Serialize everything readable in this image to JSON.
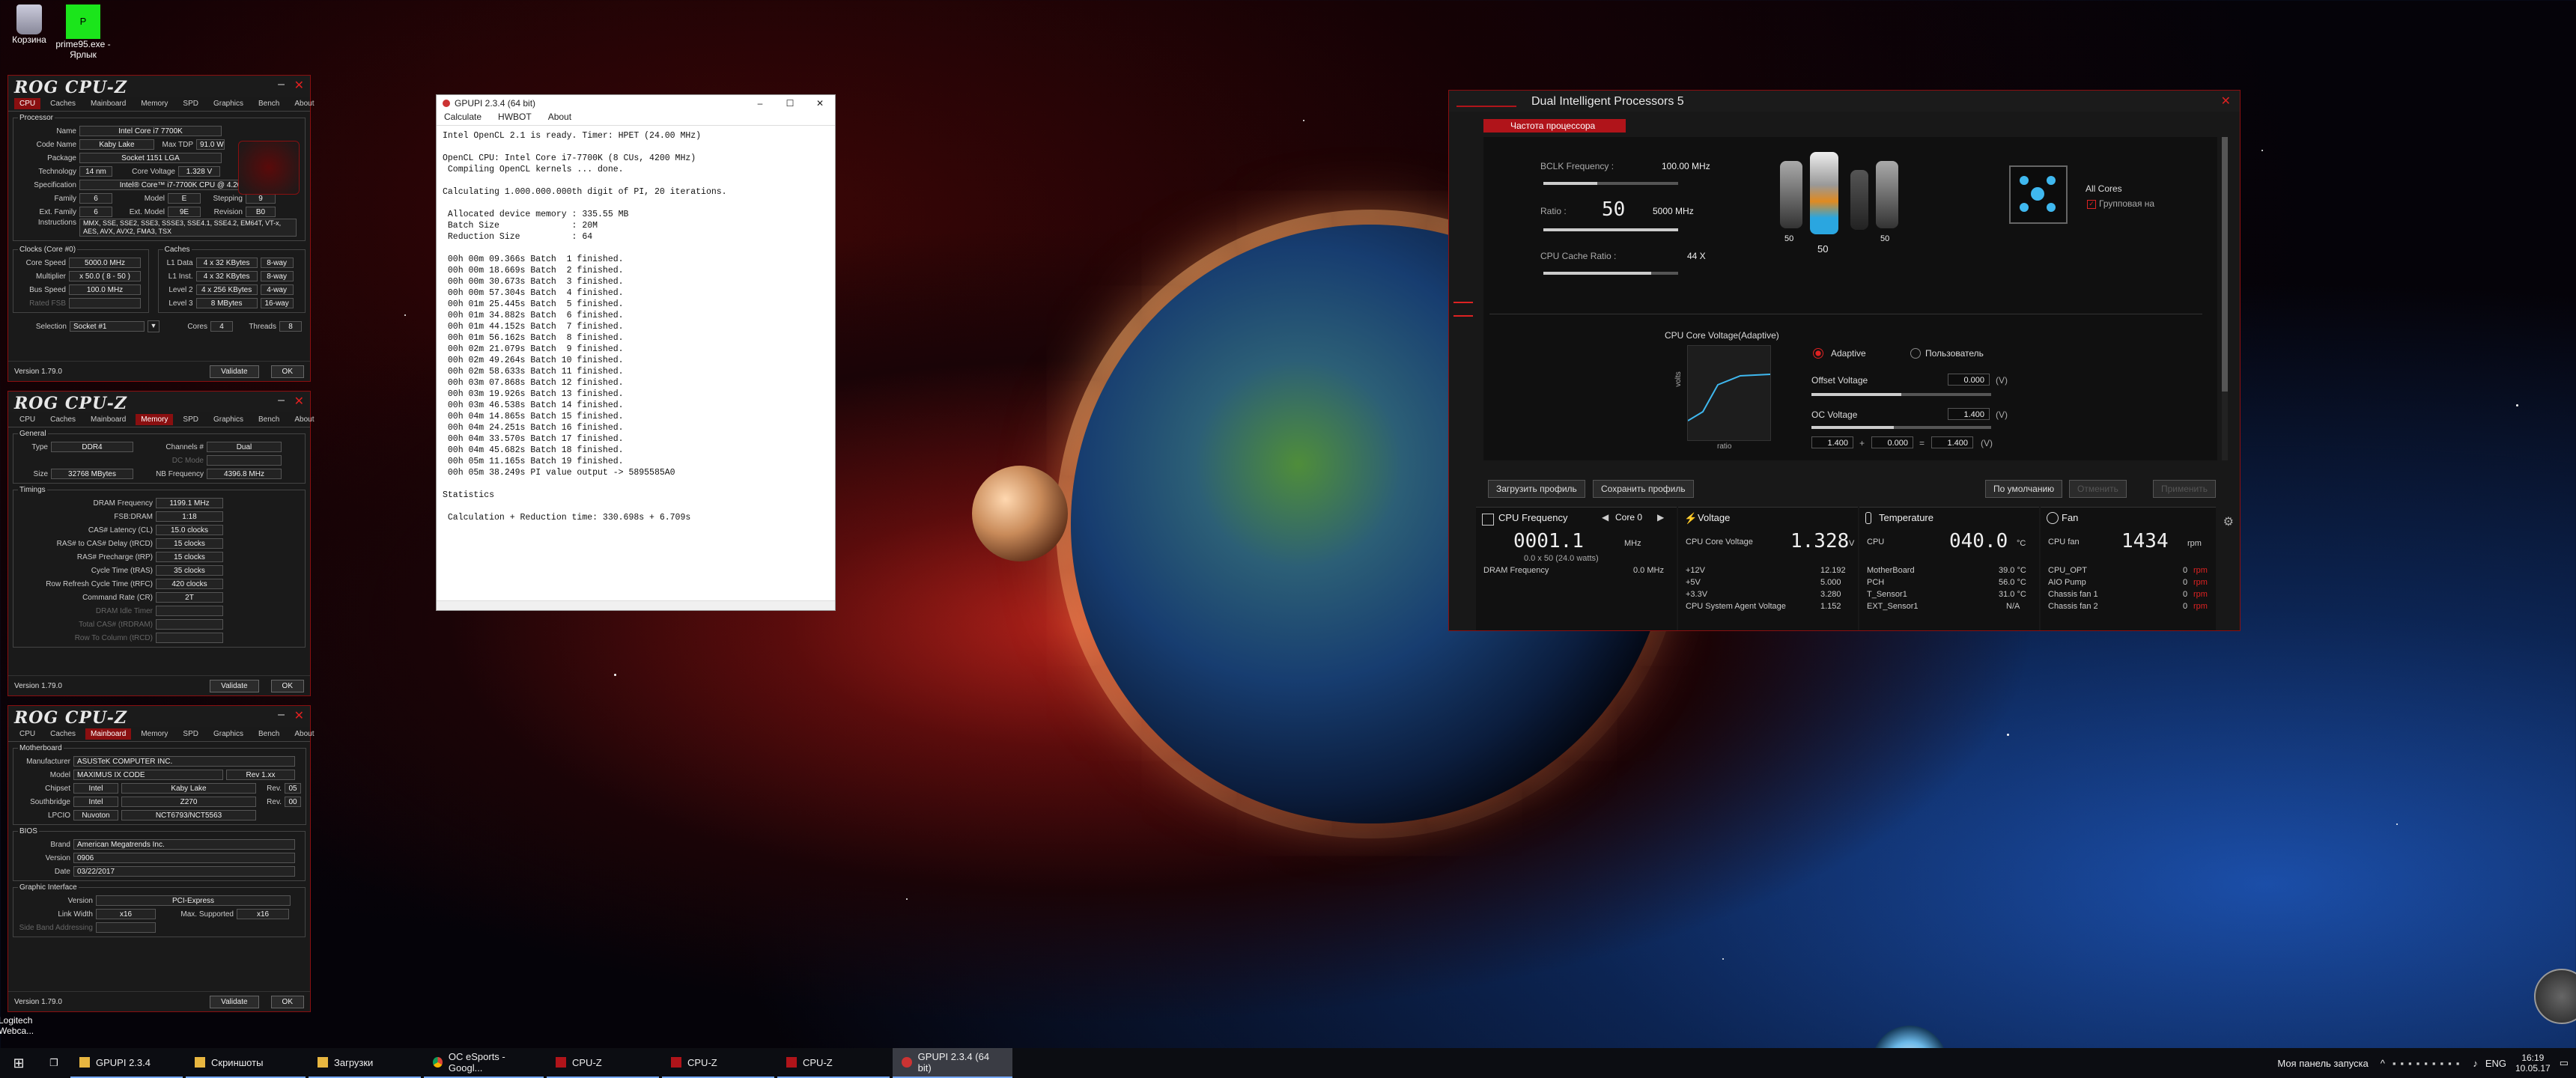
{
  "desktop": {
    "icons": [
      {
        "label": "Корзина"
      },
      {
        "label": "prime95.exe - Ярлык"
      }
    ],
    "logitech": "Logitech Webca..."
  },
  "cpuz_common": {
    "logo": "ROG CPU-Z",
    "tabs": [
      "CPU",
      "Caches",
      "Mainboard",
      "Memory",
      "SPD",
      "Graphics",
      "Bench",
      "About"
    ],
    "version": "Version 1.79.0",
    "validate": "Validate",
    "ok": "OK"
  },
  "cpuz_cpu": {
    "processor_legend": "Processor",
    "name_label": "Name",
    "name": "Intel Core i7 7700K",
    "codename_label": "Code Name",
    "codename": "Kaby Lake",
    "maxtdp_label": "Max TDP",
    "maxtdp": "91.0 W",
    "package_label": "Package",
    "package": "Socket 1151 LGA",
    "tech_label": "Technology",
    "tech": "14 nm",
    "corev_label": "Core Voltage",
    "corev": "1.328 V",
    "spec_label": "Specification",
    "spec": "Intel® Core™ i7-7700K CPU @ 4.20GHz",
    "family_label": "Family",
    "family": "6",
    "model_label": "Model",
    "model": "E",
    "stepping_label": "Stepping",
    "stepping": "9",
    "extfamily_label": "Ext. Family",
    "extfamily": "6",
    "extmodel_label": "Ext. Model",
    "extmodel": "9E",
    "revision_label": "Revision",
    "revision": "B0",
    "instr_label": "Instructions",
    "instr": "MMX, SSE, SSE2, SSE3, SSSE3, SSE4.1, SSE4.2, EM64T, VT-x, AES, AVX, AVX2, FMA3, TSX",
    "clocks_legend": "Clocks (Core #0)",
    "corespeed_label": "Core Speed",
    "corespeed": "5000.0 MHz",
    "multiplier_label": "Multiplier",
    "multiplier": "x 50.0 ( 8 - 50 )",
    "busspeed_label": "Bus Speed",
    "busspeed": "100.0 MHz",
    "ratedfsb_label": "Rated FSB",
    "caches_legend": "Caches",
    "l1d_label": "L1 Data",
    "l1d": "4 x 32 KBytes",
    "l1d_way": "8-way",
    "l1i_label": "L1 Inst.",
    "l1i": "4 x 32 KBytes",
    "l1i_way": "8-way",
    "l2_label": "Level 2",
    "l2": "4 x 256 KBytes",
    "l2_way": "4-way",
    "l3_label": "Level 3",
    "l3": "8 MBytes",
    "l3_way": "16-way",
    "selection_label": "Selection",
    "selection": "Socket #1",
    "cores_label": "Cores",
    "cores": "4",
    "threads_label": "Threads",
    "threads": "8"
  },
  "cpuz_mem": {
    "general_legend": "General",
    "type_label": "Type",
    "type": "DDR4",
    "channels_label": "Channels #",
    "channels": "Dual",
    "dcmode_label": "DC Mode",
    "size_label": "Size",
    "size": "32768 MBytes",
    "nbfreq_label": "NB Frequency",
    "nbfreq": "4396.8 MHz",
    "timings_legend": "Timings",
    "timings": [
      {
        "label": "DRAM Frequency",
        "value": "1199.1 MHz"
      },
      {
        "label": "FSB:DRAM",
        "value": "1:18"
      },
      {
        "label": "CAS# Latency (CL)",
        "value": "15.0 clocks"
      },
      {
        "label": "RAS# to CAS# Delay (tRCD)",
        "value": "15 clocks"
      },
      {
        "label": "RAS# Precharge (tRP)",
        "value": "15 clocks"
      },
      {
        "label": "Cycle Time (tRAS)",
        "value": "35 clocks"
      },
      {
        "label": "Row Refresh Cycle Time (tRFC)",
        "value": "420 clocks"
      },
      {
        "label": "Command Rate (CR)",
        "value": "2T"
      },
      {
        "label": "DRAM Idle Timer",
        "value": ""
      },
      {
        "label": "Total CAS# (tRDRAM)",
        "value": ""
      },
      {
        "label": "Row To Column (tRCD)",
        "value": ""
      }
    ]
  },
  "cpuz_mb": {
    "mb_legend": "Motherboard",
    "manu_label": "Manufacturer",
    "manu": "ASUSTeK COMPUTER INC.",
    "model_label": "Model",
    "model": "MAXIMUS IX CODE",
    "model_rev": "Rev 1.xx",
    "chipset_label": "Chipset",
    "chipset_v": "Intel",
    "chipset": "Kaby Lake",
    "chipset_rev_label": "Rev.",
    "chipset_rev": "05",
    "south_label": "Southbridge",
    "south_v": "Intel",
    "south": "Z270",
    "south_rev_label": "Rev.",
    "south_rev": "00",
    "lpcio_label": "LPCIO",
    "lpcio_v": "Nuvoton",
    "lpcio": "NCT6793/NCT5563",
    "bios_legend": "BIOS",
    "brand_label": "Brand",
    "brand": "American Megatrends Inc.",
    "version_label": "Version",
    "version": "0906",
    "date_label": "Date",
    "date": "03/22/2017",
    "gi_legend": "Graphic Interface",
    "giver_label": "Version",
    "giver": "PCI-Express",
    "lw_label": "Link Width",
    "lw": "x16",
    "maxsup_label": "Max. Supported",
    "maxsup": "x16",
    "sideband_label": "Side Band Addressing"
  },
  "gpupi": {
    "title": "GPUPI 2.3.4 (64 bit)",
    "menu": [
      "Calculate",
      "HWBOT",
      "About"
    ],
    "console": "Intel OpenCL 2.1 is ready. Timer: HPET (24.00 MHz)\n\nOpenCL CPU: Intel Core i7-7700K (8 CUs, 4200 MHz)\n Compiling OpenCL kernels ... done.\n\nCalculating 1.000.000.000th digit of PI, 20 iterations.\n\n Allocated device memory : 335.55 MB\n Batch Size              : 20M\n Reduction Size          : 64\n\n 00h 00m 09.366s Batch  1 finished.\n 00h 00m 18.669s Batch  2 finished.\n 00h 00m 30.673s Batch  3 finished.\n 00h 00m 57.304s Batch  4 finished.\n 00h 01m 25.445s Batch  5 finished.\n 00h 01m 34.882s Batch  6 finished.\n 00h 01m 44.152s Batch  7 finished.\n 00h 01m 56.162s Batch  8 finished.\n 00h 02m 21.079s Batch  9 finished.\n 00h 02m 49.264s Batch 10 finished.\n 00h 02m 58.633s Batch 11 finished.\n 00h 03m 07.868s Batch 12 finished.\n 00h 03m 19.926s Batch 13 finished.\n 00h 03m 46.538s Batch 14 finished.\n 00h 04m 14.865s Batch 15 finished.\n 00h 04m 24.251s Batch 16 finished.\n 00h 04m 33.570s Batch 17 finished.\n 00h 04m 45.682s Batch 18 finished.\n 00h 05m 11.165s Batch 19 finished.\n 00h 05m 38.249s PI value output -> 5895585A0\n\nStatistics\n\n Calculation + Reduction time: 330.698s + 6.709s"
  },
  "dip": {
    "title": "Dual Intelligent Processors 5",
    "tab": "Частота процессора",
    "bclk_label": "BCLK Frequency :",
    "bclk": "100.00 MHz",
    "ratio_label": "Ratio :",
    "ratio_big": "50",
    "ratio_mhz": "5000 MHz",
    "cache_label": "CPU Cache Ratio :",
    "cache_ratio": "44 X",
    "core_marks": [
      "50",
      "50",
      "50"
    ],
    "all_cores": "All Cores",
    "group": "Групповая на",
    "voltage_title": "CPU Core Voltage(Adaptive)",
    "volts": "volts",
    "ratio_axis": "ratio",
    "adaptive": "Adaptive",
    "user": "Пользователь",
    "offset_label": "Offset Voltage",
    "offset": "0.000",
    "v": "(V)",
    "oc_label": "OC Voltage",
    "oc": "1.400",
    "sum_a": "1.400",
    "plus": "+",
    "sum_b": "0.000",
    "eq": "=",
    "sum_c": "1.400",
    "load_profile": "Загрузить профиль",
    "save_profile": "Сохранить профиль",
    "default": "По умолчанию",
    "btn_a": "Отменить",
    "btn_b": "Применить",
    "cpufreq": {
      "head": "CPU Frequency",
      "core": "Core 0",
      "value": "0001.1",
      "unit": "MHz",
      "sub": "0.0 x 50 (24.0 watts)",
      "dram_label": "DRAM Frequency",
      "dram": "0.0 MHz"
    },
    "voltage": {
      "head": "Voltage",
      "core_label": "CPU Core Voltage",
      "core": "1.328",
      "unit": "V",
      "rows": [
        {
          "label": "+12V",
          "value": "12.192"
        },
        {
          "label": "+5V",
          "value": "5.000"
        },
        {
          "label": "+3.3V",
          "value": "3.280"
        },
        {
          "label": "CPU System Agent Voltage",
          "value": "1.152"
        }
      ]
    },
    "temp": {
      "head": "Temperature",
      "cpu_label": "CPU",
      "cpu": "040.0",
      "unit": "°C",
      "rows": [
        {
          "label": "MotherBoard",
          "value": "39.0 °C"
        },
        {
          "label": "PCH",
          "value": "56.0 °C"
        },
        {
          "label": "T_Sensor1",
          "value": "31.0 °C"
        },
        {
          "label": "EXT_Sensor1",
          "value": "N/A"
        }
      ]
    },
    "fan": {
      "head": "Fan",
      "cpu_label": "CPU fan",
      "cpu": "1434",
      "unit": "rpm",
      "rows": [
        {
          "label": "CPU_OPT",
          "value": "0"
        },
        {
          "label": "AIO Pump",
          "value": "0"
        },
        {
          "label": "Chassis fan 1",
          "value": "0"
        },
        {
          "label": "Chassis fan 2",
          "value": "0"
        }
      ],
      "rpm": "rpm"
    }
  },
  "taskbar": {
    "items": [
      {
        "label": "GPUPI 2.3.4"
      },
      {
        "label": "Скриншоты"
      },
      {
        "label": "Загрузки"
      },
      {
        "label": "OC eSports - Googl..."
      },
      {
        "label": "CPU-Z"
      },
      {
        "label": "CPU-Z"
      },
      {
        "label": "CPU-Z"
      },
      {
        "label": "GPUPI 2.3.4 (64 bit)"
      }
    ],
    "launch": "Моя панель запуска",
    "lang": "ENG",
    "time": "16:19",
    "date": "10.05.17"
  }
}
